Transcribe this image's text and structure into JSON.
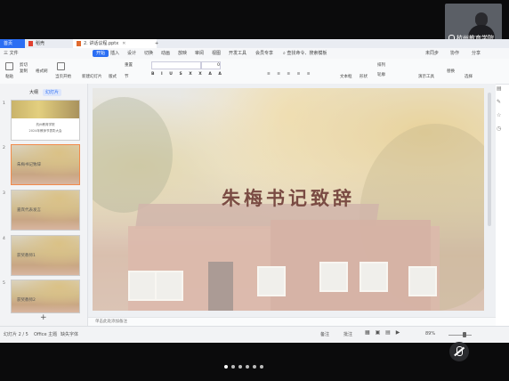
{
  "meeting": {
    "participant_name": "杭州教育学院"
  },
  "titlebar": {
    "tabs": [
      {
        "label": "首页"
      },
      {
        "label": "稻壳"
      },
      {
        "label": "2. 讲话议程.pptx"
      }
    ],
    "new_tab": "+"
  },
  "menu": {
    "items": [
      "三 文件",
      "开始",
      "插入",
      "设计",
      "切换",
      "动画",
      "放映",
      "审阅",
      "视图",
      "开发工具",
      "会员专享"
    ],
    "search": "查找命令、搜索模板",
    "right": [
      "未同步",
      "协作",
      "分享"
    ]
  },
  "ribbon": {
    "buttons": [
      "粘贴",
      "剪切",
      "复制",
      "格式刷",
      "当页开始",
      "新建幻灯片",
      "版式",
      "节",
      "重置"
    ],
    "font_size": "0",
    "right_buttons": [
      "文本框",
      "形状",
      "排列",
      "轮廓",
      "演示工具",
      "替换",
      "选择"
    ]
  },
  "leftpane": {
    "tabs": [
      "大纲",
      "幻灯片"
    ],
    "slides": [
      {
        "num": "1",
        "lines": [
          "杭州教育学院",
          "2024年教师节表彰大会"
        ]
      },
      {
        "num": "2",
        "label": "朱梅书记致辞"
      },
      {
        "num": "3",
        "label": "嘉宾代表发言"
      },
      {
        "num": "4",
        "label": "获奖教师1"
      },
      {
        "num": "5",
        "label": "获奖教师2"
      }
    ],
    "add": "+"
  },
  "slide": {
    "title": "朱梅书记致辞"
  },
  "notes": {
    "placeholder": "单击此处添加备注"
  },
  "status": {
    "slide_pos": "幻灯片 2 / 5",
    "theme": "Office 主题",
    "font": "缺失字体",
    "notes_btn": "备注",
    "comments_btn": "批注",
    "zoom": "89%"
  },
  "pager": {
    "count": 6,
    "active": 0
  }
}
